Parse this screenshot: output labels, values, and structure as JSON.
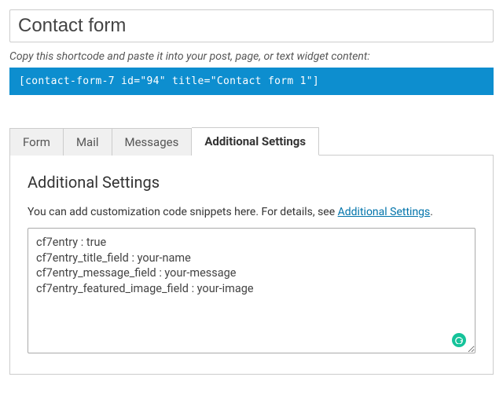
{
  "title_input": {
    "value": "Contact form"
  },
  "shortcode": {
    "help_text": "Copy this shortcode and paste it into your post, page, or text widget content:",
    "code": "[contact-form-7 id=\"94\" title=\"Contact form 1\"]"
  },
  "tabs": {
    "items": [
      {
        "label": "Form",
        "active": false
      },
      {
        "label": "Mail",
        "active": false
      },
      {
        "label": "Messages",
        "active": false
      },
      {
        "label": "Additional Settings",
        "active": true
      }
    ]
  },
  "panel": {
    "heading": "Additional Settings",
    "desc_prefix": "You can add customization code snippets here. For details, see ",
    "desc_link": "Additional Settings",
    "desc_suffix": ".",
    "code_value": "cf7entry : true\ncf7entry_title_field : your-name\ncf7entry_message_field : your-message\ncf7entry_featured_image_field : your-image"
  }
}
